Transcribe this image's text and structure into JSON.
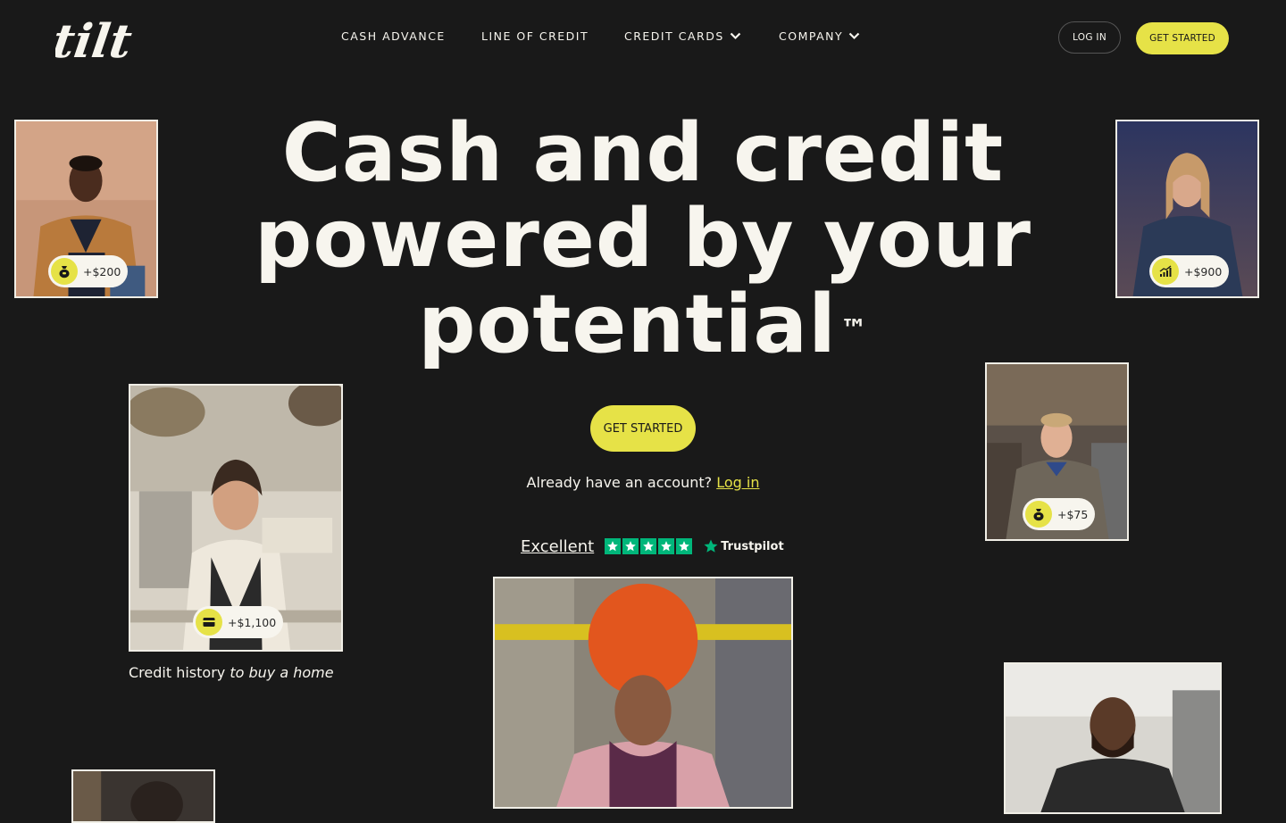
{
  "brand": {
    "logo_text": "Tilt",
    "accent": "#e6e247",
    "background": "#191919"
  },
  "nav": {
    "items": [
      {
        "label": "CASH ADVANCE",
        "dropdown": false
      },
      {
        "label": "LINE OF CREDIT",
        "dropdown": false
      },
      {
        "label": "CREDIT CARDS",
        "dropdown": true
      },
      {
        "label": "COMPANY",
        "dropdown": true
      }
    ],
    "login_label": "LOG IN",
    "get_started_label": "GET STARTED"
  },
  "hero": {
    "headline_1": "Cash and credit",
    "headline_2": "powered by your",
    "headline_3": "potential",
    "trademark": "™",
    "cta_label": "GET STARTED",
    "already_text": "Already have an account?",
    "login_link": "Log in"
  },
  "trustpilot": {
    "rating_word": "Excellent",
    "stars": 5,
    "brand": "Trustpilot",
    "star_color": "#00b67a"
  },
  "photos": {
    "p1": {
      "amount": "+$200",
      "icon": "money-bag-icon"
    },
    "p2": {
      "amount": "+$900",
      "icon": "chart-up-icon"
    },
    "p3": {
      "amount": "+$1,100",
      "icon": "credit-card-icon",
      "caption_plain": "Credit history",
      "caption_italic": "to buy a home"
    },
    "p4": {
      "amount": "+$75",
      "icon": "money-bag-icon"
    }
  }
}
